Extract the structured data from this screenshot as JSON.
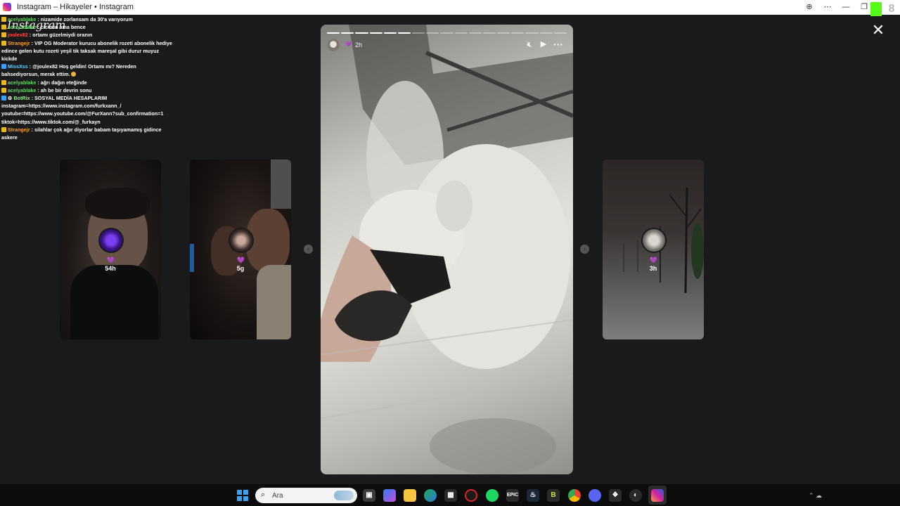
{
  "window": {
    "title": "Instagram – Hikayeler • Instagram"
  },
  "overlay": {
    "logo_text": "Instagram",
    "chat": [
      {
        "user": "acelyablake",
        "text": ": nizamide zorlansam da 30'a varıyorum",
        "color": "green"
      },
      {
        "user": "acelyablake",
        "text": ": cicimin ama bence",
        "color": "green"
      },
      {
        "user": "joulex82",
        "text": ": ortamı güzelmiydi oranın",
        "color": "red"
      },
      {
        "user": "Strangejr",
        "text": ": VIP OG Moderator kurucu abonelik rozeti abonelik hediye edince gelen kutu rozeti yeşil tik taksak mareşal gibi durur muyuz kickde",
        "color": "orange"
      },
      {
        "user": "MissXss",
        "text": ": @joulex82 Hoş geldin! Ortamı mı? Nereden bahsediyorsun, merak ettim.",
        "color": "cyan"
      },
      {
        "user": "acelyablake",
        "text": ": ağrı dağın eteğinde",
        "color": "green"
      },
      {
        "user": "acelyablake",
        "text": ": ah be bir devrin sonu",
        "color": "green"
      },
      {
        "user": "BotRix",
        "text": ": SOSYAL MEDİA HESAPLARIM instagram=https://www.instagram.com/furkxann_/ youtube=https://www.youtube.com/@FurXann?sub_confirmation=1 tiktok=https://www.tiktok.com/@_furkayn",
        "color": "lime"
      },
      {
        "user": "Strangejr",
        "text": ": silahlar çok ağır diyorlar babam taşıyamamış gidince askere",
        "color": "orange"
      }
    ]
  },
  "stories": {
    "previews": [
      {
        "time": "54h",
        "heart": "💜"
      },
      {
        "time": "5g",
        "heart": "💜"
      },
      {
        "time": "3h",
        "heart": "💜"
      }
    ],
    "current": {
      "time": "2h",
      "segments_total": 17,
      "segments_done": 6
    }
  },
  "icons": {
    "close": "close-icon",
    "mute": "mute-icon",
    "play": "play-icon",
    "more": "more-icon"
  },
  "taskbar": {
    "search_placeholder": "Ara"
  },
  "colors": {
    "background": "#1a1a1a",
    "accent_heart": "#b57bf0"
  }
}
